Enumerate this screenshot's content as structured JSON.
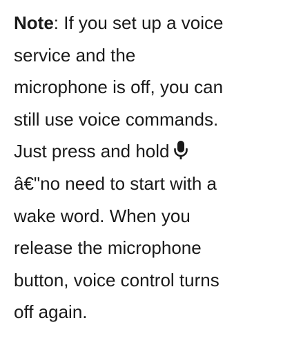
{
  "note": {
    "label": "Note",
    "lines": [
      ": If you set up a voice",
      "service and the",
      "microphone is off, you can",
      "still use voice commands.",
      "Just press and hold",
      "â€\"no need to start with a",
      "wake word. When you",
      "release the microphone",
      "button, voice control turns",
      "off again."
    ],
    "icon": "microphone-icon"
  }
}
